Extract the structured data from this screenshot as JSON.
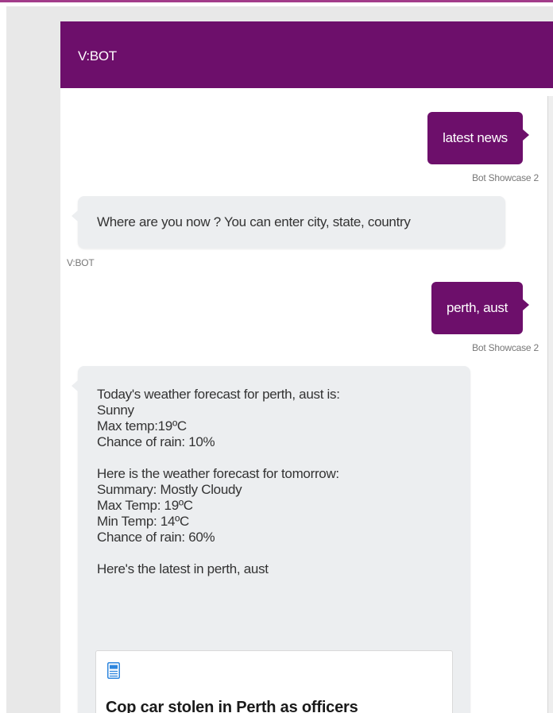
{
  "header": {
    "title": "V:BOT"
  },
  "messages": [
    {
      "from": "user",
      "text": "latest news",
      "sender": "Bot Showcase 2"
    },
    {
      "from": "bot",
      "text": "Where are you now ? You can enter city, state, country",
      "sender": "V:BOT"
    },
    {
      "from": "user",
      "text": "perth, aust",
      "sender": "Bot Showcase 2"
    },
    {
      "from": "bot",
      "lines": [
        "Today's weather forecast for perth, aust is:",
        "Sunny",
        "Max temp:19ºC",
        "Chance of rain: 10%",
        "",
        "Here is the weather forecast for tomorrow:",
        "Summary: Mostly Cloudy",
        "Max Temp: 19ºC",
        "Min Temp: 14ºC",
        "Chance of rain: 60%",
        "",
        "Here's the latest in perth, aust"
      ],
      "card": {
        "icon": "newspaper-icon",
        "title": "Cop car stolen in Perth as officers"
      }
    }
  ],
  "colors": {
    "brand": "#6d0f6b",
    "bot_bubble": "#eceef0",
    "frame": "#e8e8e8"
  }
}
